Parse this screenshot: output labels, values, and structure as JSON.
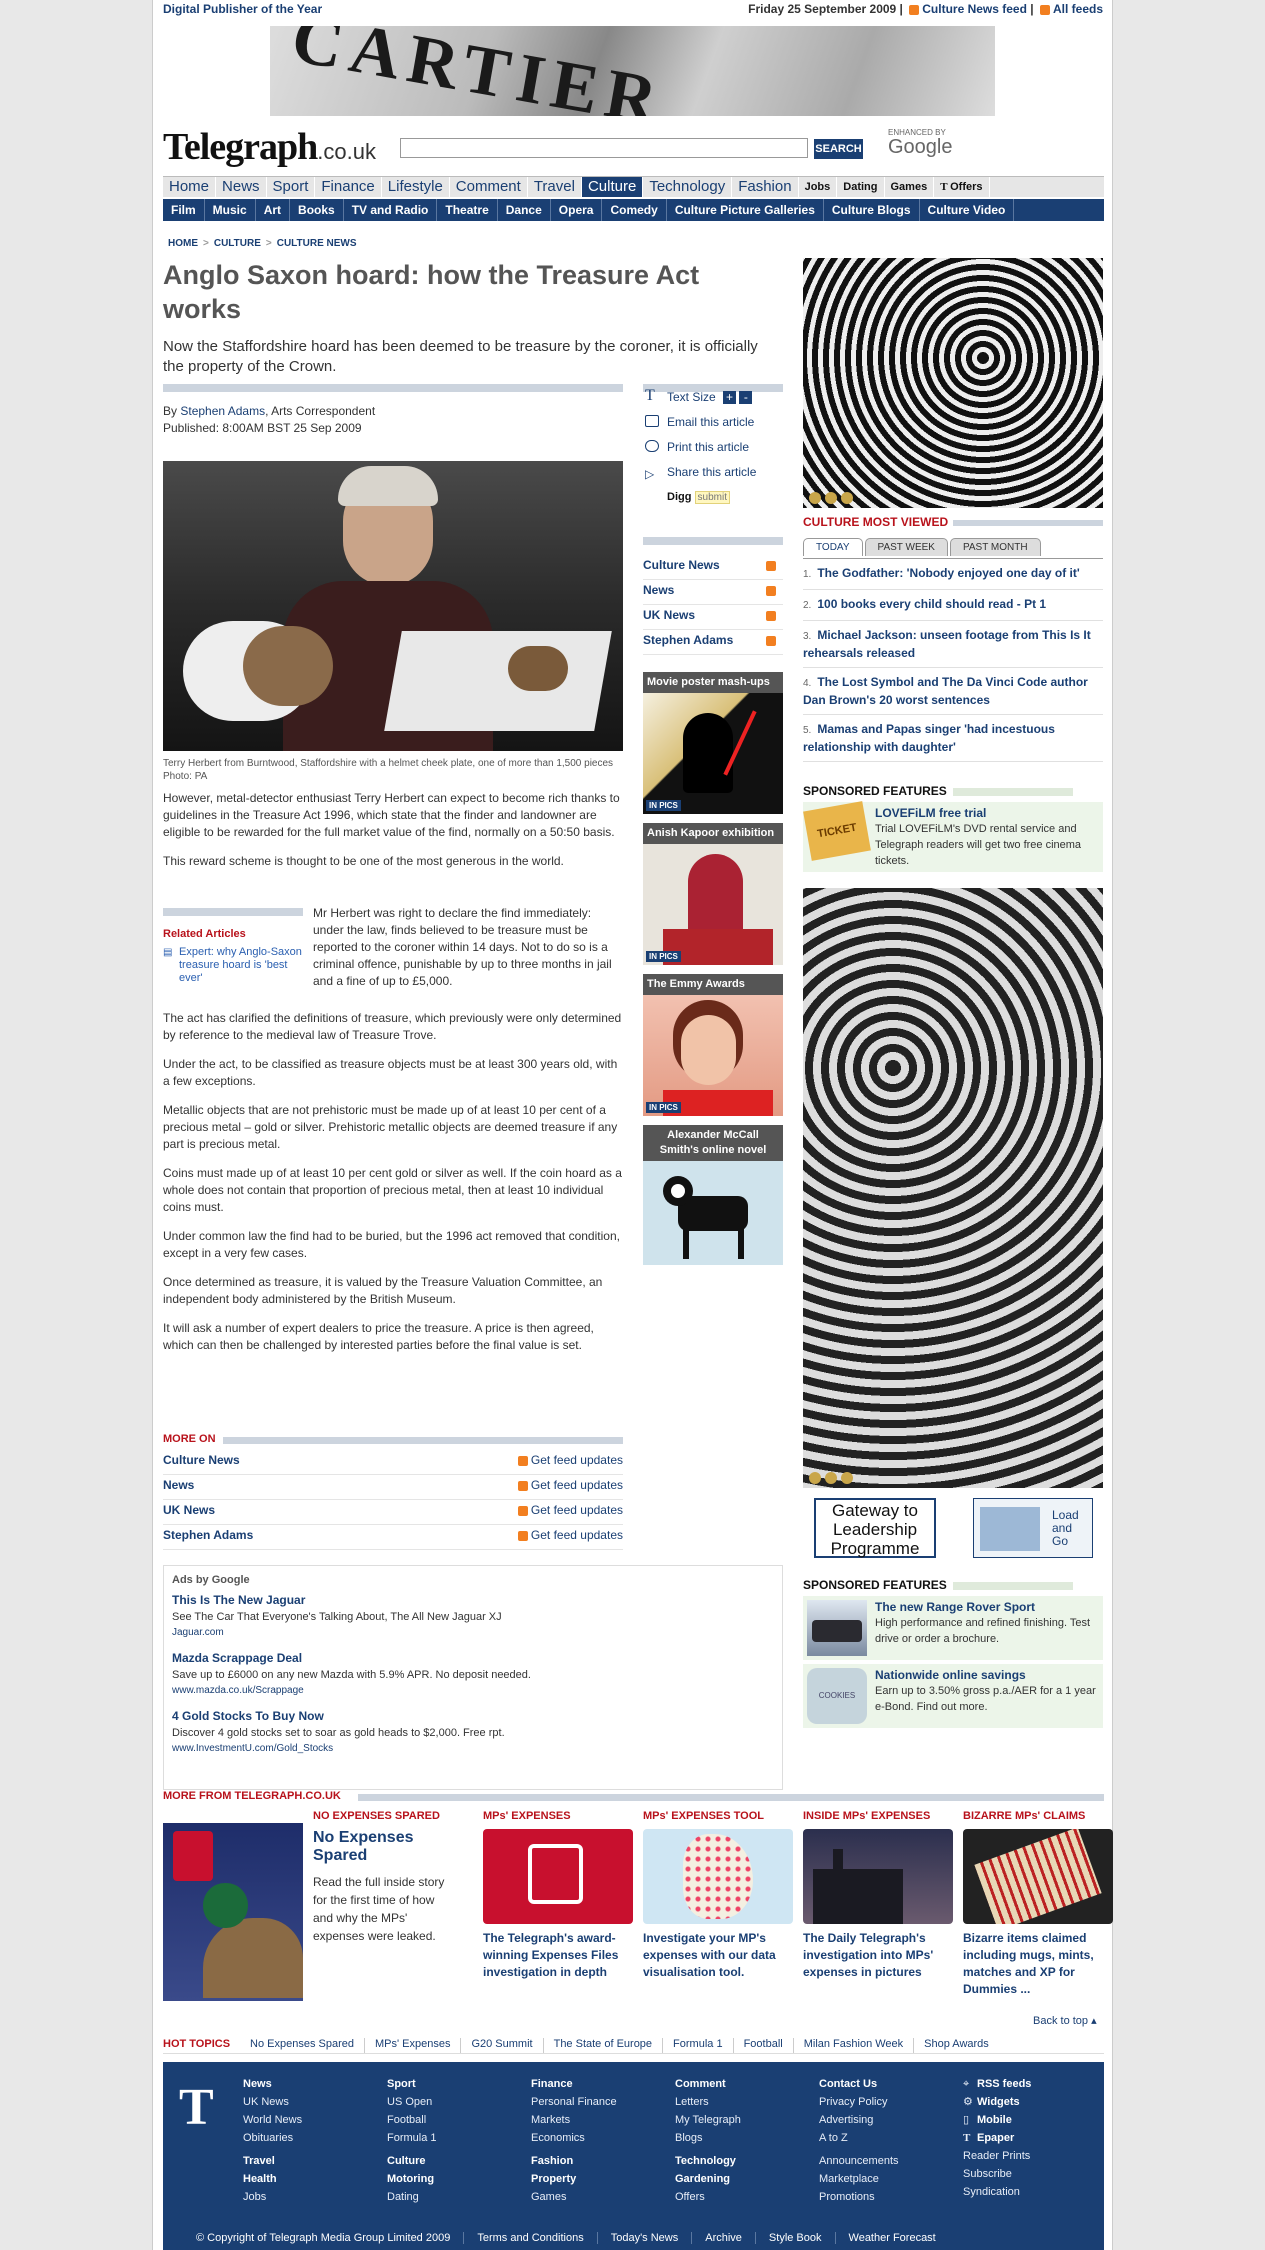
{
  "topbar": {
    "left": "Digital Publisher of the Year",
    "date": "Friday 25 September 2009",
    "feed1": "Culture News feed",
    "feed2": "All feeds"
  },
  "banner": {
    "text": "CARTIER"
  },
  "logo": {
    "name": "Telegraph",
    "suffix": ".co.uk"
  },
  "search": {
    "button": "SEARCH",
    "enhanced": "ENHANCED BY",
    "google": "Google"
  },
  "nav_main": [
    "Home",
    "News",
    "Sport",
    "Finance",
    "Lifestyle",
    "Comment",
    "Travel",
    "Culture",
    "Technology",
    "Fashion",
    "Jobs",
    "Dating",
    "Games",
    "Offers"
  ],
  "nav_sub": [
    "Film",
    "Music",
    "Art",
    "Books",
    "TV and Radio",
    "Theatre",
    "Dance",
    "Opera",
    "Comedy",
    "Culture Picture Galleries",
    "Culture Blogs",
    "Culture Video"
  ],
  "breadcrumb": [
    "HOME",
    "CULTURE",
    "CULTURE NEWS"
  ],
  "article": {
    "title": "Anglo Saxon hoard: how the Treasure Act works",
    "standfirst": "Now the Staffordshire hoard has been deemed to be treasure by the coroner, it is officially the property of the Crown.",
    "by": "By",
    "author": "Stephen Adams",
    "role": ", Arts Correspondent",
    "published": "Published: 8:00AM BST 25 Sep 2009",
    "caption": "Terry Herbert from Burntwood, Staffordshire with a helmet cheek plate, one of more than 1,500 pieces  Photo: PA",
    "p1": "However, metal-detector enthusiast Terry Herbert can expect to become rich thanks to guidelines in the Treasure Act 1996, which state that the finder and landowner are eligible to be rewarded for the full market value of the find, normally on a 50:50 basis.",
    "p2": "This reward scheme is thought to be one of the most generous in the world.",
    "p3": "Mr Herbert was right to declare the find immediately: under the law, finds believed to be treasure must be reported to the coroner within 14 days. Not to do so is a criminal offence, punishable by up to three months in jail and a fine of up to £5,000.",
    "p4": "The act has clarified the definitions of treasure, which previously were only determined by reference to the medieval law of Treasure Trove.",
    "p5": "Under the act, to be classified as treasure objects must be at least 300 years old, with a few exceptions.",
    "p6": "Metallic objects that are not prehistoric must be made up of at least 10 per cent of a precious metal – gold or silver. Prehistoric metallic objects are deemed treasure if any part is precious metal.",
    "p7": "Coins must made up of at least 10 per cent gold or silver as well. If the coin hoard as a whole does not contain that proportion of precious metal, then at least 10 individual coins must.",
    "p8": "Under common law the find had to be buried, but the 1996 act removed that condition, except in a very few cases.",
    "p9": "Once determined as treasure, it is valued by the Treasure Valuation Committee, an independent body administered by the British Museum.",
    "p10": "It will ask a number of expert dealers to price the treasure. A price is then agreed, which can then be challenged by interested parties before the final value is set."
  },
  "related": {
    "heading": "Related Articles",
    "link": "Expert: why Anglo-Saxon treasure hoard is 'best ever'"
  },
  "tools": {
    "textsize": "Text Size",
    "email": "Email this article",
    "print": "Print this article",
    "share": "Share this article",
    "digg": "Digg",
    "submit": "submit"
  },
  "feeds": [
    "Culture News",
    "News",
    "UK News",
    "Stephen Adams"
  ],
  "pics": [
    {
      "title": "Movie poster mash-ups",
      "badge": "IN PICS"
    },
    {
      "title": "Anish Kapoor exhibition",
      "badge": "IN PICS"
    },
    {
      "title": "The Emmy Awards",
      "badge": "IN PICS"
    },
    {
      "title": "Alexander McCall Smith's online novel",
      "badge": ""
    }
  ],
  "most_viewed": {
    "heading": "CULTURE MOST VIEWED",
    "tabs": [
      "TODAY",
      "PAST WEEK",
      "PAST MONTH"
    ],
    "items": [
      {
        "n": "1.",
        "t": "The Godfather: 'Nobody enjoyed one day of it'"
      },
      {
        "n": "2.",
        "t": "100 books every child should read - Pt 1"
      },
      {
        "n": "3.",
        "t": "Michael Jackson: unseen footage from This Is It rehearsals released"
      },
      {
        "n": "4.",
        "t": "The Lost Symbol and The Da Vinci Code author Dan Brown's 20 worst sentences"
      },
      {
        "n": "5.",
        "t": "Mamas and Papas singer 'had incestuous relationship with daughter'"
      }
    ]
  },
  "sponsored1": {
    "heading": "SPONSORED FEATURES",
    "title": "LOVEFiLM free trial",
    "desc": "Trial LOVEFiLM's DVD rental service and Telegraph readers will get two free cinema tickets.",
    "img": "TICKET"
  },
  "gateway": {
    "a": "Gateway to Leadership Programme",
    "b": "Load and Go"
  },
  "sponsored2": {
    "heading": "SPONSORED FEATURES",
    "items": [
      {
        "title": "The new Range Rover Sport",
        "desc": "High performance and refined finishing. Test drive or order a brochure."
      },
      {
        "title": "Nationwide online savings",
        "desc": "Earn up to 3.50% gross p.a./AER for a 1 year e-Bond. Find out more.",
        "img": "COOKIES"
      }
    ]
  },
  "more_on": {
    "heading": "MORE ON",
    "items": [
      "Culture News",
      "News",
      "UK News",
      "Stephen Adams"
    ],
    "feed": "Get feed updates"
  },
  "google_ads": {
    "heading": "Ads by Google",
    "ads": [
      {
        "t": "This Is The New Jaguar",
        "d": "See The Car That Everyone's Talking About, The All New Jaguar XJ",
        "u": "Jaguar.com"
      },
      {
        "t": "Mazda Scrappage Deal",
        "d": "Save up to £6000 on any new Mazda with 5.9% APR. No deposit needed.",
        "u": "www.mazda.co.uk/Scrappage"
      },
      {
        "t": "4 Gold Stocks To Buy Now",
        "d": "Discover 4 gold stocks set to soar as gold heads to $2,000. Free rpt.",
        "u": "www.InvestmentU.com/Gold_Stocks"
      }
    ]
  },
  "more_from": {
    "heading": "MORE FROM TELEGRAPH.CO.UK",
    "feature": {
      "kicker": "NO EXPENSES SPARED",
      "title": "No Expenses Spared",
      "desc": "Read the full inside story for the first time of how and why the MPs' expenses were leaked."
    },
    "cols": [
      {
        "k": "MPs' EXPENSES",
        "c": "The Telegraph's award-winning Expenses Files investigation in depth"
      },
      {
        "k": "MPs' EXPENSES TOOL",
        "c": "Investigate your MP's expenses with our data visualisation tool."
      },
      {
        "k": "INSIDE MPs' EXPENSES",
        "c": "The Daily Telegraph's investigation into MPs' expenses in pictures"
      },
      {
        "k": "BIZARRE MPs' CLAIMS",
        "c": "Bizarre items claimed including mugs, mints, matches and XP for Dummies ..."
      }
    ]
  },
  "back_to_top": "Back to top",
  "hot_topics": {
    "label": "HOT TOPICS",
    "items": [
      "No Expenses Spared",
      "MPs' Expenses",
      "G20 Summit",
      "The State of Europe",
      "Formula 1",
      "Football",
      "Milan Fashion Week",
      "Shop Awards"
    ]
  },
  "footer": {
    "cols": [
      {
        "h": "News",
        "l": [
          "UK News",
          "World News",
          "Obituaries"
        ],
        "h2": "Travel",
        "h3": "Health",
        "l2": [
          "Jobs"
        ]
      },
      {
        "h": "Sport",
        "l": [
          "US Open",
          "Football",
          "Formula 1"
        ],
        "h2": "Culture",
        "h3": "Motoring",
        "l2": [
          "Dating"
        ]
      },
      {
        "h": "Finance",
        "l": [
          "Personal Finance",
          "Markets",
          "Economics"
        ],
        "h2": "Fashion",
        "h3": "Property",
        "l2": [
          "Games"
        ]
      },
      {
        "h": "Comment",
        "l": [
          "Letters",
          "My Telegraph",
          "Blogs"
        ],
        "h2": "Technology",
        "h3": "Gardening",
        "l2": [
          "Offers"
        ]
      },
      {
        "h": "Contact Us",
        "l": [
          "Privacy Policy",
          "Advertising",
          "A to Z",
          "",
          "Announcements",
          "Marketplace",
          "Promotions"
        ]
      },
      {
        "h": "RSS feeds",
        "l": [
          "Widgets",
          "Mobile",
          "Epaper",
          "Reader Prints",
          "Subscribe",
          "Syndication"
        ]
      }
    ],
    "copyright": "© Copyright of Telegraph Media Group Limited 2009",
    "links": [
      "Terms and Conditions",
      "Today's News",
      "Archive",
      "Style Book",
      "Weather Forecast"
    ]
  }
}
